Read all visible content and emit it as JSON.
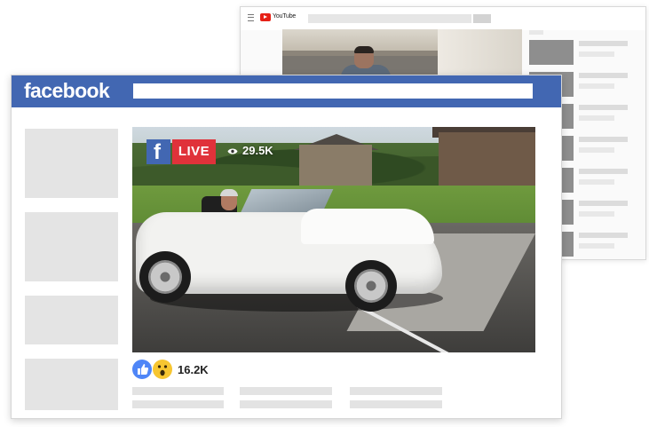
{
  "youtube": {
    "brand": "YouTube",
    "colors": {
      "logo": "#e62117",
      "thumb": "#8e8e8e"
    }
  },
  "facebook": {
    "logo": "facebook",
    "header_color": "#4267b2",
    "live": {
      "badge": "LIVE",
      "views": "29.5K",
      "badge_color": "#e0323a"
    },
    "reactions": {
      "count": "16.2K",
      "icons": [
        "like-icon",
        "wow-icon"
      ]
    }
  }
}
